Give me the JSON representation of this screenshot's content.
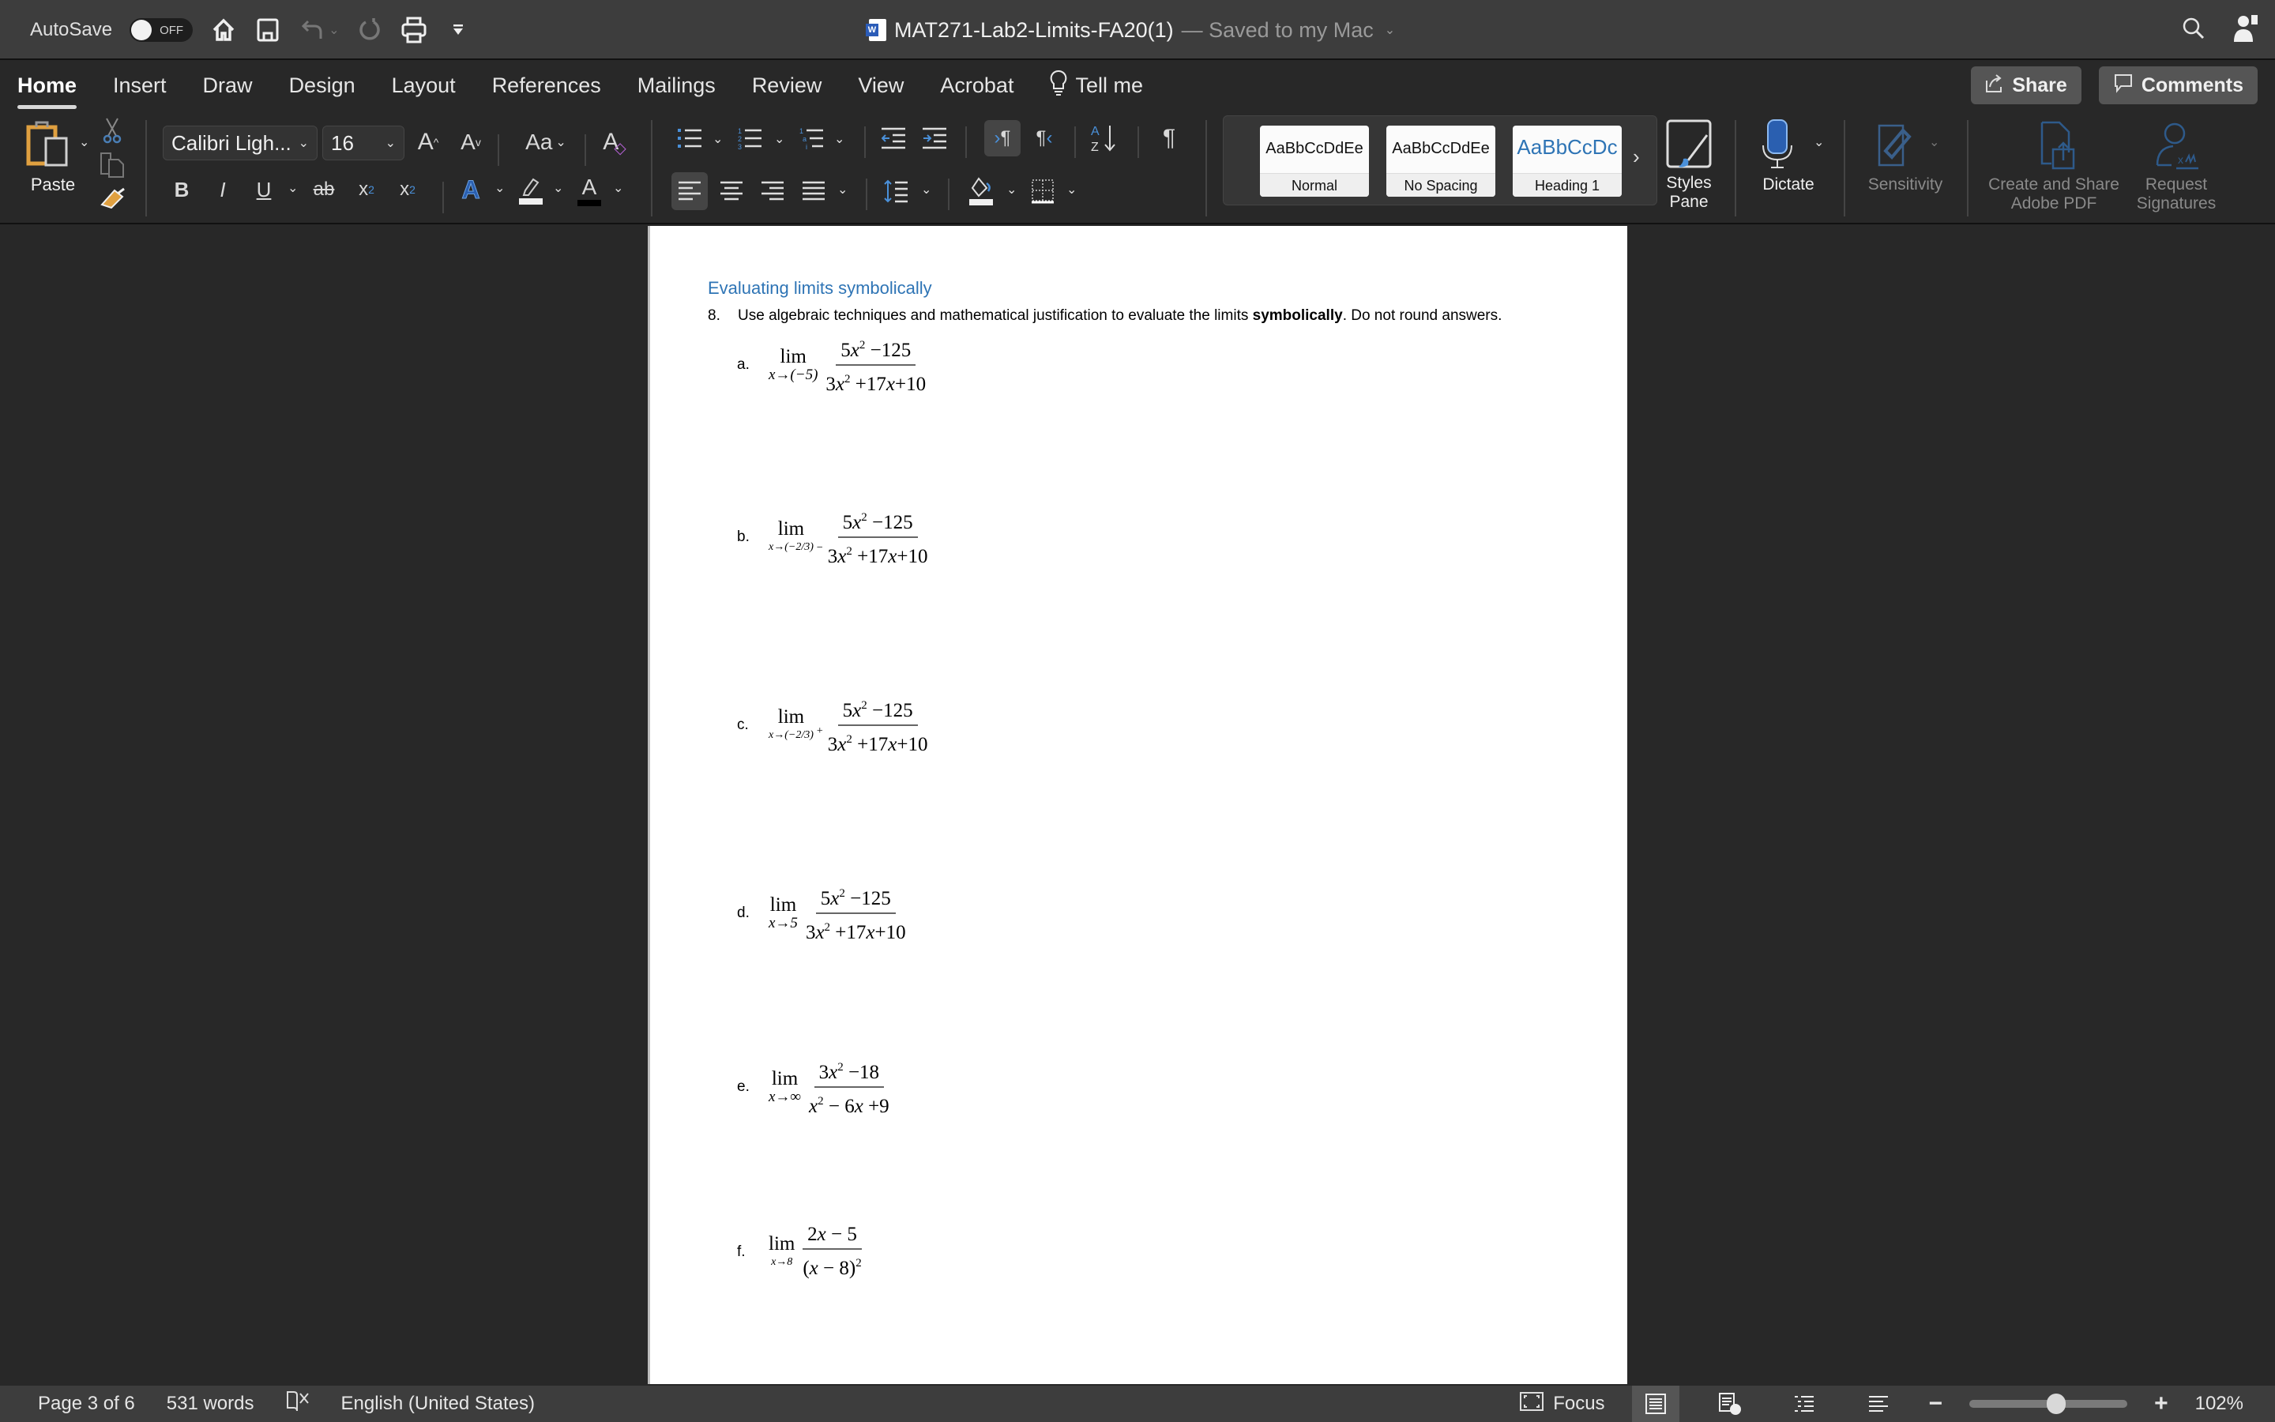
{
  "titlebar": {
    "autosave_label": "AutoSave",
    "autosave_state": "OFF",
    "doc_title": "MAT271-Lab2-Limits-FA20(1)",
    "save_status": "— Saved to my Mac",
    "icons": [
      "home-icon",
      "save-icon",
      "undo-icon",
      "redo-icon",
      "print-icon",
      "customize-toolbar-icon",
      "search-icon",
      "account-icon"
    ]
  },
  "tabs": [
    {
      "label": "Home",
      "active": true
    },
    {
      "label": "Insert"
    },
    {
      "label": "Draw"
    },
    {
      "label": "Design"
    },
    {
      "label": "Layout"
    },
    {
      "label": "References"
    },
    {
      "label": "Mailings"
    },
    {
      "label": "Review"
    },
    {
      "label": "View"
    },
    {
      "label": "Acrobat"
    }
  ],
  "tell_me": "Tell me",
  "share_label": "Share",
  "comments_label": "Comments",
  "ribbon": {
    "paste_label": "Paste",
    "font_name": "Calibri Ligh...",
    "font_size": "16",
    "change_case": "Aa",
    "styles": [
      {
        "sample": "AaBbCcDdEe",
        "name": "Normal"
      },
      {
        "sample": "AaBbCcDdEe",
        "name": "No Spacing"
      },
      {
        "sample": "AaBbCcDc",
        "name": "Heading 1"
      }
    ],
    "styles_pane_label": "Styles Pane",
    "dictate_label": "Dictate",
    "sensitivity_label": "Sensitivity",
    "adobe_pdf_label_1": "Create and Share",
    "adobe_pdf_label_2": "Adobe PDF",
    "request_sig_label_1": "Request",
    "request_sig_label_2": "Signatures"
  },
  "document": {
    "heading": "Evaluating limits symbolically",
    "question_number": "8.",
    "question_text_1": "Use algebraic techniques and mathematical justification to evaluate the limits ",
    "question_bold": "symbolically",
    "question_text_2": ". Do not round answers.",
    "items": [
      {
        "letter": "a.",
        "approach": "x→(−5)",
        "numerator": "5x² −125",
        "denominator": "3x² +17x+10",
        "side": ""
      },
      {
        "letter": "b.",
        "approach": "x→(−2/3)",
        "numerator": "5x² −125",
        "denominator": "3x² +17x+10",
        "side": "−"
      },
      {
        "letter": "c.",
        "approach": "x→(−2/3)",
        "numerator": "5x² −125",
        "denominator": "3x² +17x+10",
        "side": "+"
      },
      {
        "letter": "d.",
        "approach": "x→5",
        "numerator": "5x² −125",
        "denominator": "3x² +17x+10",
        "side": ""
      },
      {
        "letter": "e.",
        "approach": "x→∞",
        "numerator": "3x² −18",
        "denominator": "x² − 6x +9",
        "side": ""
      },
      {
        "letter": "f.",
        "approach": "x→8",
        "numerator": "2x − 5",
        "denominator": "(x − 8)²",
        "side": ""
      }
    ],
    "lim_word": "lim"
  },
  "statusbar": {
    "page": "Page 3 of 6",
    "words": "531 words",
    "language": "English (United States)",
    "focus_label": "Focus",
    "zoom_level": "102%",
    "zoom_fraction": 0.55
  }
}
